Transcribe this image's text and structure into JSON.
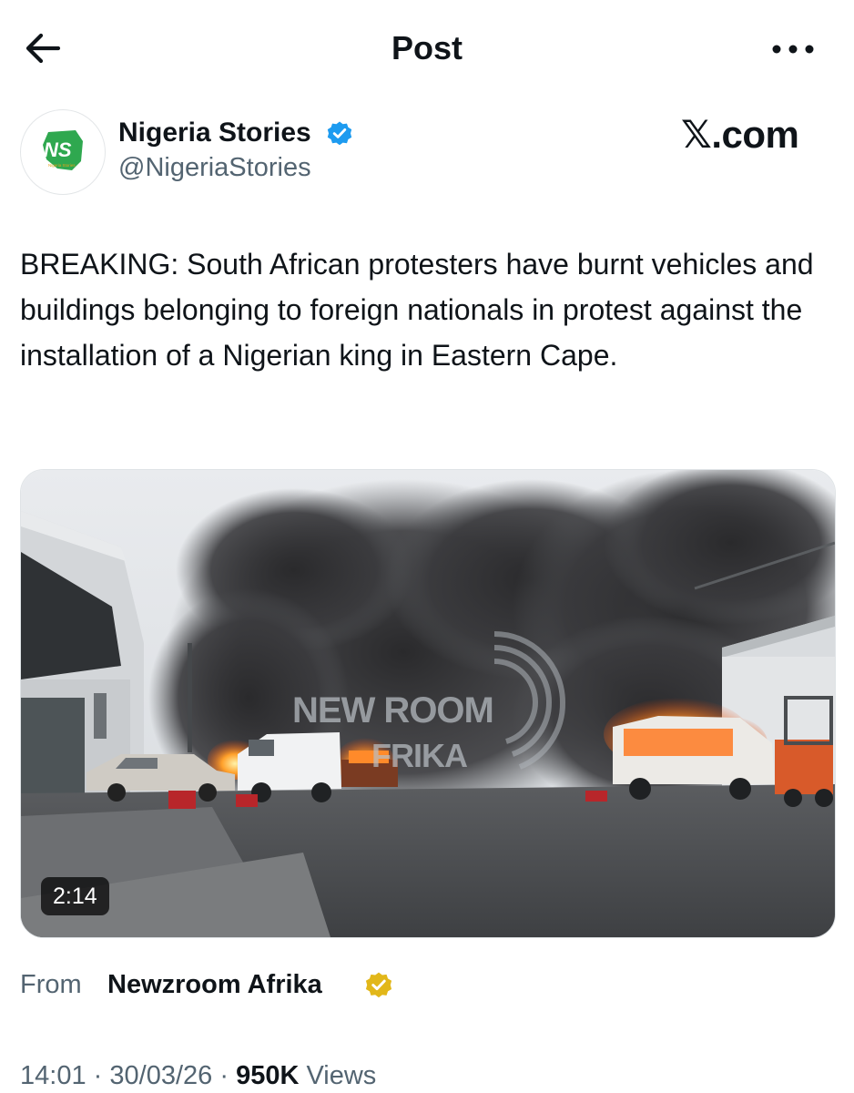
{
  "header": {
    "title": "Post",
    "back_icon": "arrow-left-icon",
    "more_icon": "more-horizontal-icon"
  },
  "author": {
    "display_name": "Nigeria Stories",
    "handle": "@NigeriaStories",
    "verified": true,
    "verified_color": "#1d9bf0",
    "avatar_text": "NS",
    "avatar_subtext": "Nigeria Stories"
  },
  "source_badge": "𝕏.com",
  "post": {
    "text": "BREAKING: South African protesters have burnt vehicles and buildings belonging to foreign nationals in protest against the installation of a Nigerian king in Eastern Cape."
  },
  "media": {
    "duration": "2:14",
    "watermark_line1": "NEW ROOM",
    "watermark_line2": "FRIKA"
  },
  "from": {
    "label": "From",
    "name": "Newzroom Afrika",
    "badge_color": "#e2b719"
  },
  "meta": {
    "time": "14:01",
    "separator": "·",
    "date": "30/03/26",
    "views_count": "950K",
    "views_label": "Views"
  },
  "colors": {
    "text_primary": "#0f1419",
    "text_secondary": "#536471",
    "fire": "#ff6a1a"
  }
}
